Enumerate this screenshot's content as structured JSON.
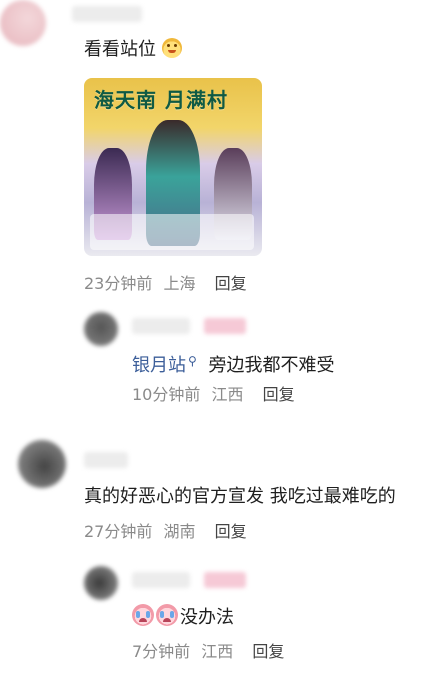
{
  "comments": [
    {
      "text": "看看站位",
      "has_image": true,
      "meta": {
        "time": "23分钟前",
        "location": "上海",
        "reply": "回复"
      },
      "reply": {
        "mention": "银月站",
        "text": "旁边我都不难受",
        "meta": {
          "time": "10分钟前",
          "location": "江西",
          "reply": "回复"
        }
      }
    },
    {
      "text": "真的好恶心的官方宣发 我吃过最难吃的",
      "meta": {
        "time": "27分钟前",
        "location": "湖南",
        "reply": "回复"
      },
      "reply": {
        "text": "没办法",
        "meta": {
          "time": "7分钟前",
          "location": "江西",
          "reply": "回复"
        }
      }
    }
  ],
  "poster": {
    "title": "海天南 月满村"
  },
  "icons": {
    "search_icon_after_mention": "search-icon",
    "emoji_1": "laughing-pig-emoji",
    "emoji_2": "crying-emoji"
  },
  "colors": {
    "link": "#3d5f9a",
    "meta": "#8a8a8a",
    "blur_pink": "#f6c9d6"
  }
}
